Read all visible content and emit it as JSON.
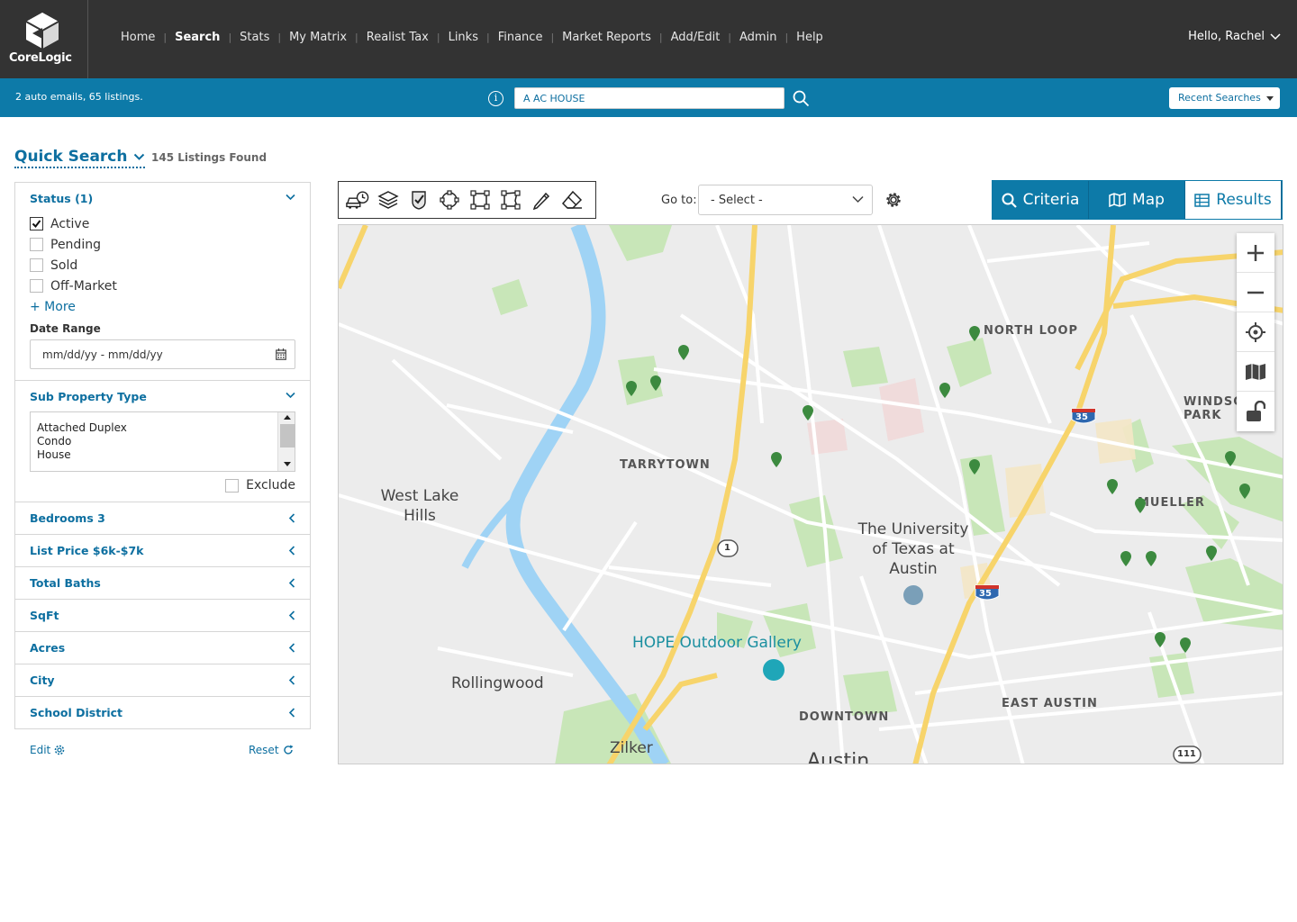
{
  "brand": {
    "name": "CoreLogic",
    "trademark": "®"
  },
  "nav": {
    "items": [
      {
        "label": "Home",
        "active": false
      },
      {
        "label": "Search",
        "active": true
      },
      {
        "label": "Stats",
        "active": false
      },
      {
        "label": "My Matrix",
        "active": false
      },
      {
        "label": "Realist Tax",
        "active": false
      },
      {
        "label": "Links",
        "active": false
      },
      {
        "label": "Finance",
        "active": false
      },
      {
        "label": "Market Reports",
        "active": false
      },
      {
        "label": "Add/Edit",
        "active": false
      },
      {
        "label": "Admin",
        "active": false
      },
      {
        "label": "Help",
        "active": false
      }
    ],
    "greeting": "Hello, Rachel"
  },
  "bluebar": {
    "auto_emails": "2 auto emails, 65 listings.",
    "search_value": "A AC HOUSE",
    "recent_searches": "Recent Searches"
  },
  "header": {
    "title": "Quick Search",
    "listings_found": "145 Listings Found"
  },
  "criteria": {
    "status": {
      "title": "Status (1)",
      "options": [
        {
          "label": "Active",
          "checked": true
        },
        {
          "label": "Pending",
          "checked": false
        },
        {
          "label": "Sold",
          "checked": false
        },
        {
          "label": "Off-Market",
          "checked": false
        }
      ],
      "more": "+ More",
      "date_range_label": "Date Range",
      "date_range_placeholder": "mm/dd/yy - mm/dd/yy"
    },
    "sub_property_type": {
      "title": "Sub Property Type",
      "options": [
        "Attached Duplex",
        "Condo",
        "House"
      ],
      "exclude_label": "Exclude"
    },
    "collapsed": [
      "Bedrooms 3",
      "List Price $6k-$7k",
      "Total Baths",
      "SqFt",
      "Acres",
      "City",
      "School District"
    ],
    "edit": "Edit",
    "reset": "Reset"
  },
  "map_toolbar": {
    "tools": [
      "commute-icon",
      "layers-icon",
      "shield-check-icon",
      "circle-draw-icon",
      "rectangle-draw-icon",
      "polygon-draw-icon",
      "pencil-icon",
      "eraser-icon"
    ],
    "goto_label": "Go to:",
    "goto_value": "- Select -"
  },
  "view_tabs": [
    {
      "label": "Criteria",
      "icon": "search-icon",
      "active": false
    },
    {
      "label": "Map",
      "icon": "map-icon",
      "active": false
    },
    {
      "label": "Results",
      "icon": "grid-icon",
      "active": true
    }
  ],
  "map": {
    "labels": {
      "north_loop": "NORTH LOOP",
      "windsor": "WINDSOR PARK",
      "tarrytown": "TARRYTOWN",
      "mueller": "MUELLER",
      "west_lake_hills": "West Lake Hills",
      "ut": "The University of Texas at Austin",
      "hope": "HOPE Outdoor Gallery",
      "rollingwood": "Rollingwood",
      "downtown": "DOWNTOWN",
      "east_austin": "EAST AUSTIN",
      "zilker": "Zilker",
      "austin": "Austin",
      "route_1": "1",
      "i35": "35",
      "route_111": "111"
    },
    "listing_count_visible": 22,
    "colors": {
      "pin": "#3c8a3f",
      "water": "#9fd3f5",
      "park": "#c8e6b8",
      "highway": "#f7d46b"
    }
  }
}
